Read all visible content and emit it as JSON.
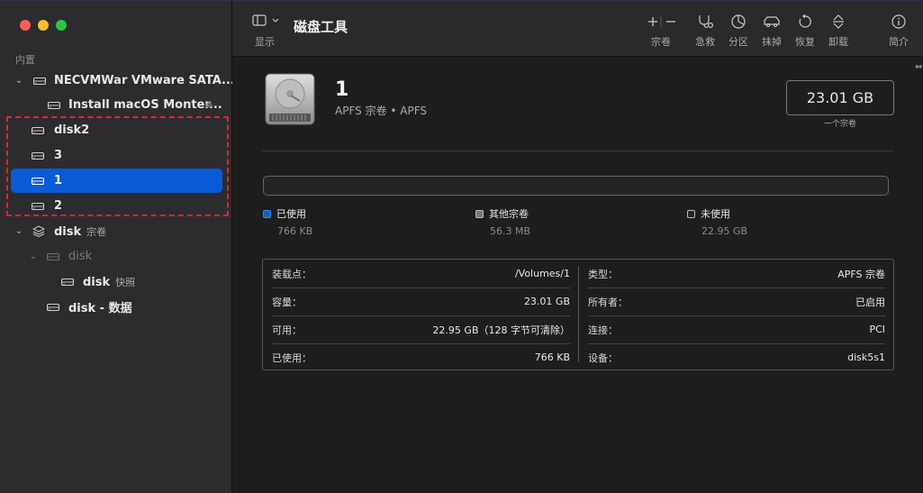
{
  "sidebar": {
    "section_label": "内置",
    "items": [
      {
        "label": "NECVMWar VMware SATA...",
        "sub": ""
      },
      {
        "label": "Install macOS Monter...",
        "sub": ""
      },
      {
        "label": "disk2",
        "sub": ""
      },
      {
        "label": "3",
        "sub": ""
      },
      {
        "label": "1",
        "sub": ""
      },
      {
        "label": "2",
        "sub": ""
      },
      {
        "label": "disk",
        "sub": "宗卷"
      },
      {
        "label": "disk",
        "sub": ""
      },
      {
        "label": "disk",
        "sub": "快照"
      },
      {
        "label": "disk - 数据",
        "sub": ""
      }
    ]
  },
  "toolbar": {
    "view_label": "显示",
    "title": "磁盘工具",
    "volume_label": "宗卷",
    "first_aid_label": "急救",
    "partition_label": "分区",
    "erase_label": "抹掉",
    "restore_label": "恢复",
    "unmount_label": "卸载",
    "info_label": "简介"
  },
  "volume": {
    "name": "1",
    "subtitle": "APFS 宗卷 • APFS",
    "size": "23.01 GB",
    "size_caption": "一个宗卷"
  },
  "usage": {
    "used": {
      "label": "已使用",
      "value": "766 KB",
      "color": "#1e8fff"
    },
    "other": {
      "label": "其他宗卷",
      "value": "56.3 MB",
      "color": "#9a9a9a"
    },
    "free": {
      "label": "未使用",
      "value": "22.95 GB",
      "color": "#2a2a2a"
    }
  },
  "info": {
    "left": [
      {
        "k": "装载点：",
        "v": "/Volumes/1"
      },
      {
        "k": "容量：",
        "v": "23.01 GB"
      },
      {
        "k": "可用：",
        "v": "22.95 GB（128 字节可清除）"
      },
      {
        "k": "已使用：",
        "v": "766 KB"
      }
    ],
    "right": [
      {
        "k": "类型：",
        "v": "APFS 宗卷"
      },
      {
        "k": "所有者：",
        "v": "已启用"
      },
      {
        "k": "连接：",
        "v": "PCI"
      },
      {
        "k": "设备：",
        "v": "disk5s1"
      }
    ]
  },
  "colors": {
    "accent": "#0a5bd5",
    "highlight_border": "#e3242b"
  }
}
